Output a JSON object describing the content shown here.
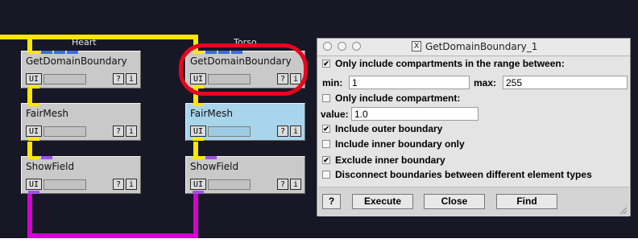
{
  "network": {
    "group_labels": {
      "left": "Heart",
      "right": "Torso"
    },
    "modules": [
      {
        "id": "heart-getdomainboundary",
        "title": "GetDomainBoundary",
        "ui": "UI",
        "help": "?",
        "info": "i"
      },
      {
        "id": "heart-fairmesh",
        "title": "FairMesh",
        "ui": "UI",
        "help": "?",
        "info": "i"
      },
      {
        "id": "heart-showfield",
        "title": "ShowField",
        "ui": "UI",
        "help": "?",
        "info": "i"
      },
      {
        "id": "torso-getdomainboundary",
        "title": "GetDomainBoundary",
        "ui": "UI",
        "help": "?",
        "info": "i"
      },
      {
        "id": "torso-fairmesh",
        "title": "FairMesh",
        "ui": "UI",
        "help": "?",
        "info": "i"
      },
      {
        "id": "torso-showfield",
        "title": "ShowField",
        "ui": "UI",
        "help": "?",
        "info": "i"
      }
    ],
    "colors": {
      "background": "#171726",
      "wire_geometry": "#ffe600",
      "wire_field": "#d400d4",
      "module": "#c9c9c9",
      "module_selected": "#a8d4ec",
      "highlight": "#e8051e"
    }
  },
  "dialog": {
    "title": "GetDomainBoundary_1",
    "window_icon": "X",
    "options": {
      "only_range": {
        "label": "Only include compartments in the range between:",
        "checked": true
      },
      "min_label": "min:",
      "min_value": "1",
      "max_label": "max:",
      "max_value": "255",
      "only_compartment": {
        "label": "Only include compartment:",
        "checked": false
      },
      "value_label": "value:",
      "value_value": "1.0",
      "outer": {
        "label": "Include outer boundary",
        "checked": true
      },
      "inner_only": {
        "label": "Include inner boundary only",
        "checked": false
      },
      "exclude_inner": {
        "label": "Exclude inner boundary",
        "checked": true
      },
      "disconnect": {
        "label": "Disconnect boundaries between different element types",
        "checked": false
      }
    },
    "buttons": {
      "help": "?",
      "execute": "Execute",
      "close": "Close",
      "find": "Find"
    }
  }
}
